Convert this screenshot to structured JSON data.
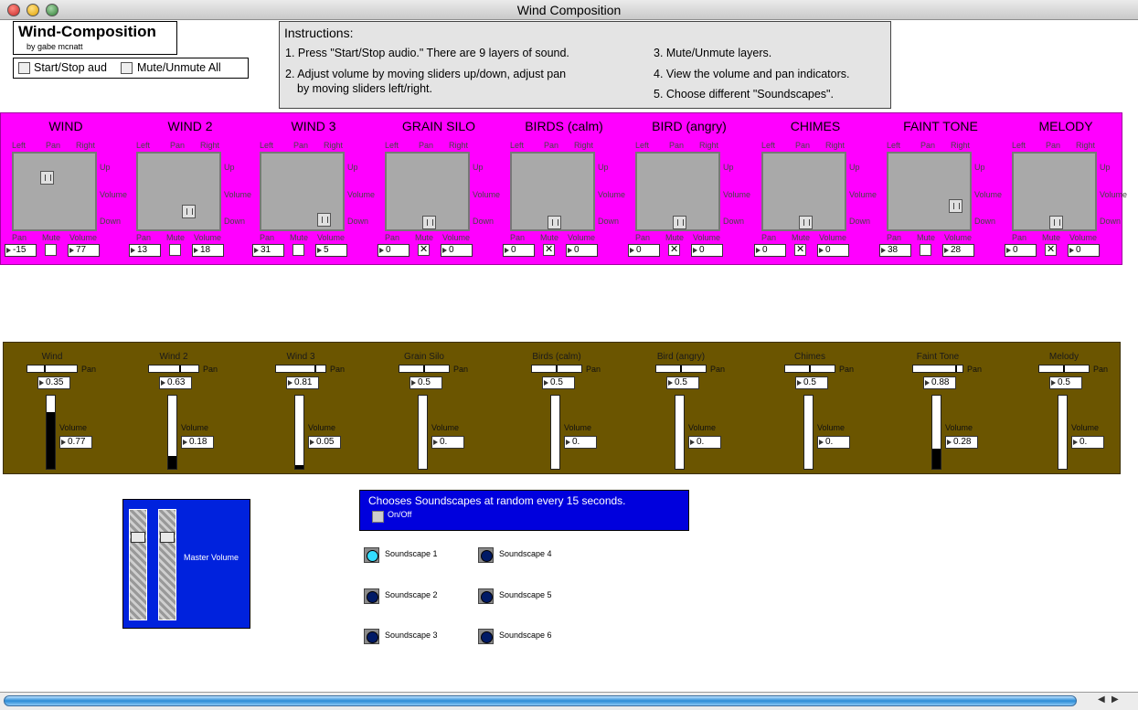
{
  "window": {
    "title": "Wind Composition"
  },
  "app": {
    "title": "Wind-Composition",
    "byline": "by gabe mcnatt",
    "start_stop": "Start/Stop aud",
    "mute_all": "Mute/Unmute All"
  },
  "instructions": {
    "heading": "Instructions:",
    "i1": "1. Press \"Start/Stop audio.\" There are 9 layers of sound.",
    "i2a": "2. Adjust volume by moving sliders up/down, adjust pan",
    "i2b": "by moving sliders left/right.",
    "i3": "3. Mute/Unmute layers.",
    "i4": "4. View the volume and pan indicators.",
    "i5": "5. Choose different \"Soundscapes\"."
  },
  "pad_labels": {
    "left": "Left",
    "pan": "Pan",
    "right": "Right",
    "up": "Up",
    "volume": "Volume",
    "down": "Down",
    "pan_b": "Pan",
    "mute": "Mute",
    "volume_b": "Volume"
  },
  "layers": [
    {
      "name": "WIND",
      "pan": "-15",
      "volume": "77",
      "muted": false,
      "knob_pan": 0.35,
      "knob_vol": 0.77
    },
    {
      "name": "WIND 2",
      "pan": "13",
      "volume": "18",
      "muted": false,
      "knob_pan": 0.63,
      "knob_vol": 0.18
    },
    {
      "name": "WIND 3",
      "pan": "31",
      "volume": "5",
      "muted": false,
      "knob_pan": 0.81,
      "knob_vol": 0.05
    },
    {
      "name": "GRAIN SILO",
      "pan": "0",
      "volume": "0",
      "muted": true,
      "knob_pan": 0.5,
      "knob_vol": 0
    },
    {
      "name": "BIRDS (calm)",
      "pan": "0",
      "volume": "0",
      "muted": true,
      "knob_pan": 0.5,
      "knob_vol": 0
    },
    {
      "name": "BIRD (angry)",
      "pan": "0",
      "volume": "0",
      "muted": true,
      "knob_pan": 0.5,
      "knob_vol": 0
    },
    {
      "name": "CHIMES",
      "pan": "0",
      "volume": "0",
      "muted": true,
      "knob_pan": 0.5,
      "knob_vol": 0
    },
    {
      "name": "FAINT TONE",
      "pan": "38",
      "volume": "28",
      "muted": false,
      "knob_pan": 0.88,
      "knob_vol": 0.28
    },
    {
      "name": "MELODY",
      "pan": "0",
      "volume": "0",
      "muted": true,
      "knob_pan": 0.5,
      "knob_vol": 0
    }
  ],
  "indicator_labels": {
    "pan": "Pan",
    "volume": "Volume"
  },
  "indicators": [
    {
      "name": "Wind",
      "pan": "0.35",
      "volume": "0.77",
      "pan_level": 0.35,
      "vol_level": 0.77
    },
    {
      "name": "Wind 2",
      "pan": "0.63",
      "volume": "0.18",
      "pan_level": 0.63,
      "vol_level": 0.18
    },
    {
      "name": "Wind 3",
      "pan": "0.81",
      "volume": "0.05",
      "pan_level": 0.81,
      "vol_level": 0.05
    },
    {
      "name": "Grain Silo",
      "pan": "0.5",
      "volume": "0.",
      "pan_level": 0.5,
      "vol_level": 0
    },
    {
      "name": "Birds (calm)",
      "pan": "0.5",
      "volume": "0.",
      "pan_level": 0.5,
      "vol_level": 0
    },
    {
      "name": "Bird (angry)",
      "pan": "0.5",
      "volume": "0.",
      "pan_level": 0.5,
      "vol_level": 0
    },
    {
      "name": "Chimes",
      "pan": "0.5",
      "volume": "0.",
      "pan_level": 0.5,
      "vol_level": 0
    },
    {
      "name": "Faint Tone",
      "pan": "0.88",
      "volume": "0.28",
      "pan_level": 0.88,
      "vol_level": 0.28
    },
    {
      "name": "Melody",
      "pan": "0.5",
      "volume": "0.",
      "pan_level": 0.5,
      "vol_level": 0
    }
  ],
  "master": {
    "label": "Master Volume",
    "left_level": 0.78,
    "right_level": 0.78
  },
  "random": {
    "text": "Chooses Soundscapes at random every 15 seconds.",
    "onoff": "On/Off"
  },
  "soundscapes": [
    {
      "label": "Soundscape 1",
      "selected": true
    },
    {
      "label": "Soundscape 2",
      "selected": false
    },
    {
      "label": "Soundscape 3",
      "selected": false
    },
    {
      "label": "Soundscape 4",
      "selected": false
    },
    {
      "label": "Soundscape 5",
      "selected": false
    },
    {
      "label": "Soundscape 6",
      "selected": false
    }
  ],
  "colors": {
    "layer_panel": "#ff00ff",
    "indicator_panel": "#6b5500",
    "master_panel": "#0022dd",
    "random_panel": "#0000dd"
  }
}
